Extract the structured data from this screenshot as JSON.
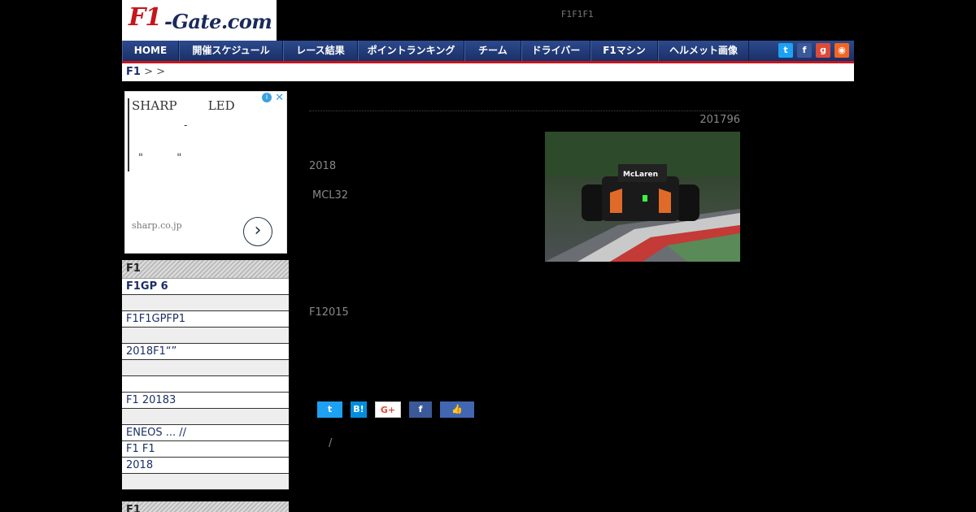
{
  "header": {
    "logo_f1": "F1",
    "logo_rest": "-Gate.com",
    "tagline": "F1F1F1"
  },
  "nav": {
    "items": [
      "HOME",
      "開催スケジュール",
      "レース結果",
      "ポイントランキング",
      "チーム",
      "ドライバー",
      "F1マシン",
      "ヘルメット画像"
    ],
    "social": [
      "twitter-icon",
      "facebook-icon",
      "google-plus-icon",
      "rss-icon"
    ]
  },
  "breadcrumb": {
    "root": "F1",
    "sep1": ">",
    "sep2": ">"
  },
  "ad": {
    "line1": "SHARP        LED",
    "line2": "-",
    "line3": "\"          \"",
    "domain": "sharp.co.jp"
  },
  "sidebar": {
    "head": "F1",
    "items": [
      "F1GP 6",
      "",
      "F1F1GPFP1",
      "",
      "2018F1“”",
      "",
      "",
      "F1 20183",
      "",
      "ENEOS ... //",
      "F1  F1",
      "2018",
      ""
    ],
    "head2": "F1"
  },
  "article": {
    "date": "201796",
    "text1": "2018",
    "text2": "MCL32",
    "text3": "F12015",
    "photo_label": "McLaren"
  },
  "share": {
    "slash": "/"
  },
  "colors": {
    "nav": "#1b2f66",
    "accent": "#c4161c"
  }
}
